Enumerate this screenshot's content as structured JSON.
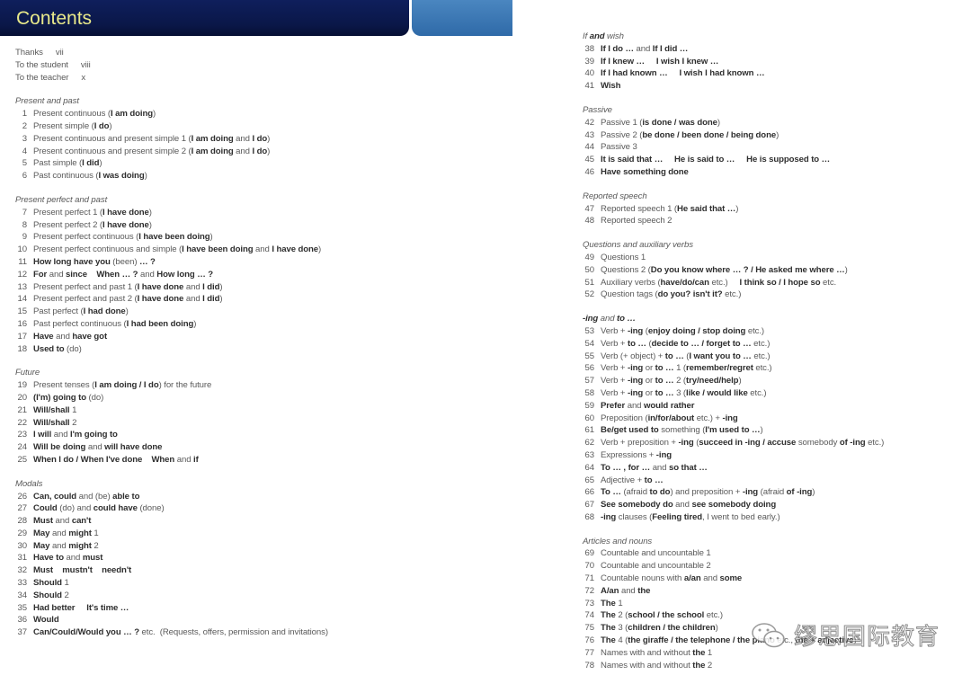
{
  "header": {
    "title": "Contents",
    "colors": {
      "bar": "#0a1748",
      "title": "#e8e98a",
      "tab": "#3b78b5"
    }
  },
  "front_matter": [
    {
      "label": "Thanks",
      "page": "vii"
    },
    {
      "label": "To the student",
      "page": "viii"
    },
    {
      "label": "To the teacher",
      "page": "x"
    }
  ],
  "left_sections": [
    {
      "title": [
        "Present and past"
      ],
      "entries": [
        {
          "n": "1",
          "p": [
            "Present continuous (",
            "I am doing",
            ")"
          ]
        },
        {
          "n": "2",
          "p": [
            "Present simple (",
            "I do",
            ")"
          ]
        },
        {
          "n": "3",
          "p": [
            "Present continuous and present simple 1 (",
            "I am doing",
            " and ",
            "I do",
            ")"
          ]
        },
        {
          "n": "4",
          "p": [
            "Present continuous and present simple 2 (",
            "I am doing",
            " and ",
            "I do",
            ")"
          ]
        },
        {
          "n": "5",
          "p": [
            "Past simple (",
            "I did",
            ")"
          ]
        },
        {
          "n": "6",
          "p": [
            "Past continuous (",
            "I was doing",
            ")"
          ]
        }
      ]
    },
    {
      "title": [
        "Present perfect and past"
      ],
      "entries": [
        {
          "n": "7",
          "p": [
            "Present perfect 1 (",
            "I have done",
            ")"
          ]
        },
        {
          "n": "8",
          "p": [
            "Present perfect 2 (",
            "I have done",
            ")"
          ]
        },
        {
          "n": "9",
          "p": [
            "Present perfect continuous (",
            "I have been doing",
            ")"
          ]
        },
        {
          "n": "10",
          "p": [
            "Present perfect continuous and simple (",
            "I have been doing",
            " and ",
            "I have done",
            ")"
          ]
        },
        {
          "n": "11",
          "p": [
            "",
            "How long have you",
            " (been) ",
            "… ?"
          ]
        },
        {
          "n": "12",
          "p": [
            "",
            "For",
            " and ",
            "since",
            "    ",
            "When … ?",
            " and ",
            "How long … ?"
          ]
        },
        {
          "n": "13",
          "p": [
            "Present perfect and past 1 (",
            "I have done",
            " and ",
            "I did",
            ")"
          ]
        },
        {
          "n": "14",
          "p": [
            "Present perfect and past 2 (",
            "I have done",
            " and ",
            "I did",
            ")"
          ]
        },
        {
          "n": "15",
          "p": [
            "Past perfect (",
            "I had done",
            ")"
          ]
        },
        {
          "n": "16",
          "p": [
            "Past perfect continuous (",
            "I had been doing",
            ")"
          ]
        },
        {
          "n": "17",
          "p": [
            "",
            "Have",
            " and ",
            "have got"
          ]
        },
        {
          "n": "18",
          "p": [
            "",
            "Used to",
            " (do)"
          ]
        }
      ]
    },
    {
      "title": [
        "Future"
      ],
      "entries": [
        {
          "n": "19",
          "p": [
            "Present tenses (",
            "I am doing / I do",
            ") for the future"
          ]
        },
        {
          "n": "20",
          "p": [
            "",
            "(I'm) going to",
            " (do)"
          ]
        },
        {
          "n": "21",
          "p": [
            "",
            "Will/shall",
            " 1"
          ]
        },
        {
          "n": "22",
          "p": [
            "",
            "Will/shall",
            " 2"
          ]
        },
        {
          "n": "23",
          "p": [
            "",
            "I will",
            " and ",
            "I'm going to"
          ]
        },
        {
          "n": "24",
          "p": [
            "",
            "Will be doing",
            " and ",
            "will have done"
          ]
        },
        {
          "n": "25",
          "p": [
            "",
            "When I do / When I've done",
            "    ",
            "When",
            " and ",
            "if"
          ]
        }
      ]
    },
    {
      "title": [
        "Modals"
      ],
      "entries": [
        {
          "n": "26",
          "p": [
            "",
            "Can, could",
            " and (be) ",
            "able to"
          ]
        },
        {
          "n": "27",
          "p": [
            "",
            "Could",
            " (do) and ",
            "could have",
            " (done)"
          ]
        },
        {
          "n": "28",
          "p": [
            "",
            "Must",
            " and ",
            "can't"
          ]
        },
        {
          "n": "29",
          "p": [
            "",
            "May",
            " and ",
            "might",
            " 1"
          ]
        },
        {
          "n": "30",
          "p": [
            "",
            "May",
            " and ",
            "might",
            " 2"
          ]
        },
        {
          "n": "31",
          "p": [
            "",
            "Have to",
            " and ",
            "must"
          ]
        },
        {
          "n": "32",
          "p": [
            "",
            "Must    mustn't    needn't"
          ]
        },
        {
          "n": "33",
          "p": [
            "",
            "Should",
            " 1"
          ]
        },
        {
          "n": "34",
          "p": [
            "",
            "Should",
            " 2"
          ]
        },
        {
          "n": "35",
          "p": [
            "",
            "Had better     It's time …"
          ]
        },
        {
          "n": "36",
          "p": [
            "",
            "Would"
          ]
        },
        {
          "n": "37",
          "p": [
            "",
            "Can/Could/Would you … ?",
            " etc.  (Requests, offers, permission and invitations)"
          ]
        }
      ]
    }
  ],
  "right_sections": [
    {
      "title": [
        "If",
        " and ",
        "wish"
      ],
      "entries": [
        {
          "n": "38",
          "p": [
            "",
            "If I do …",
            " and ",
            "If I did …"
          ]
        },
        {
          "n": "39",
          "p": [
            "",
            "If I knew …     I wish I knew …"
          ]
        },
        {
          "n": "40",
          "p": [
            "",
            "If I had known …     I wish I had known …"
          ]
        },
        {
          "n": "41",
          "p": [
            "",
            "Wish"
          ]
        }
      ]
    },
    {
      "title": [
        "Passive"
      ],
      "entries": [
        {
          "n": "42",
          "p": [
            "Passive 1 (",
            "is done / was done",
            ")"
          ]
        },
        {
          "n": "43",
          "p": [
            "Passive 2 (",
            "be done / been done / being done",
            ")"
          ]
        },
        {
          "n": "44",
          "p": [
            "Passive 3"
          ]
        },
        {
          "n": "45",
          "p": [
            "",
            "It is said that …     He is said to …     He is supposed to …"
          ]
        },
        {
          "n": "46",
          "p": [
            "",
            "Have something done"
          ]
        }
      ]
    },
    {
      "title": [
        "Reported speech"
      ],
      "entries": [
        {
          "n": "47",
          "p": [
            "Reported speech 1 (",
            "He said that …",
            ")"
          ]
        },
        {
          "n": "48",
          "p": [
            "Reported speech 2"
          ]
        }
      ]
    },
    {
      "title": [
        "Questions and auxiliary verbs"
      ],
      "entries": [
        {
          "n": "49",
          "p": [
            "Questions 1"
          ]
        },
        {
          "n": "50",
          "p": [
            "Questions 2 (",
            "Do you know where … ? / He asked me where …",
            ")"
          ]
        },
        {
          "n": "51",
          "p": [
            "Auxiliary verbs (",
            "have/do/can",
            " etc.)     ",
            "I think so / I hope so",
            " etc."
          ]
        },
        {
          "n": "52",
          "p": [
            "Question tags (",
            "do you? isn't it?",
            " etc.)"
          ]
        }
      ]
    },
    {
      "title": [
        "",
        "-ing",
        " and ",
        "to …"
      ],
      "entries": [
        {
          "n": "53",
          "p": [
            "Verb + ",
            "-ing",
            " (",
            "enjoy doing / stop doing",
            " etc.)"
          ]
        },
        {
          "n": "54",
          "p": [
            "Verb + ",
            "to …",
            " (",
            "decide to … / forget to …",
            " etc.)"
          ]
        },
        {
          "n": "55",
          "p": [
            "Verb (+ object) + ",
            "to …",
            " (",
            "I want you to …",
            " etc.)"
          ]
        },
        {
          "n": "56",
          "p": [
            "Verb + ",
            "-ing",
            " or ",
            "to …",
            " 1 (",
            "remember/regret",
            " etc.)"
          ]
        },
        {
          "n": "57",
          "p": [
            "Verb + ",
            "-ing",
            " or ",
            "to …",
            " 2 (",
            "try/need/help",
            ")"
          ]
        },
        {
          "n": "58",
          "p": [
            "Verb + ",
            "-ing",
            " or ",
            "to …",
            " 3 (",
            "like / would like",
            " etc.)"
          ]
        },
        {
          "n": "59",
          "p": [
            "",
            "Prefer",
            " and ",
            "would rather"
          ]
        },
        {
          "n": "60",
          "p": [
            "Preposition (",
            "in/for/about",
            " etc.) + ",
            "-ing"
          ]
        },
        {
          "n": "61",
          "p": [
            "",
            "Be/get used to",
            " something (",
            "I'm used to …",
            ")"
          ]
        },
        {
          "n": "62",
          "p": [
            "Verb + preposition + ",
            "-ing",
            " (",
            "succeed in -ing / accuse",
            " somebody ",
            "of -ing",
            " etc.)"
          ]
        },
        {
          "n": "63",
          "p": [
            "Expressions + ",
            "-ing"
          ]
        },
        {
          "n": "64",
          "p": [
            "",
            "To … , for …",
            " and ",
            "so that …"
          ]
        },
        {
          "n": "65",
          "p": [
            "Adjective + ",
            "to …"
          ]
        },
        {
          "n": "66",
          "p": [
            "",
            "To …",
            " (afraid ",
            "to do",
            ") and preposition + ",
            "-ing",
            " (afraid ",
            "of -ing",
            ")"
          ]
        },
        {
          "n": "67",
          "p": [
            "",
            "See somebody do",
            " and ",
            "see somebody doing"
          ]
        },
        {
          "n": "68",
          "p": [
            "",
            "-ing",
            " clauses (",
            "Feeling tired",
            ", I went to bed early.)"
          ]
        }
      ]
    },
    {
      "title": [
        "Articles and nouns"
      ],
      "entries": [
        {
          "n": "69",
          "p": [
            "Countable and uncountable 1"
          ]
        },
        {
          "n": "70",
          "p": [
            "Countable and uncountable 2"
          ]
        },
        {
          "n": "71",
          "p": [
            "Countable nouns with ",
            "a/an",
            " and ",
            "some"
          ]
        },
        {
          "n": "72",
          "p": [
            "",
            "A/an",
            " and ",
            "the"
          ]
        },
        {
          "n": "73",
          "p": [
            "",
            "The",
            " 1"
          ]
        },
        {
          "n": "74",
          "p": [
            "",
            "The",
            " 2 (",
            "school / the school",
            " etc.)"
          ]
        },
        {
          "n": "75",
          "p": [
            "",
            "The",
            " 3 (",
            "children / the children",
            ")"
          ]
        },
        {
          "n": "76",
          "p": [
            "",
            "The",
            " 4 (",
            "the giraffe / the telephone / the piano",
            " etc., ",
            "the + adjective",
            ")"
          ]
        },
        {
          "n": "77",
          "p": [
            "Names with and without ",
            "the",
            " 1"
          ]
        },
        {
          "n": "78",
          "p": [
            "Names with and without ",
            "the",
            " 2"
          ]
        }
      ]
    }
  ],
  "watermark": {
    "icon": "wechat-icon",
    "text": "缪思国际教育"
  }
}
